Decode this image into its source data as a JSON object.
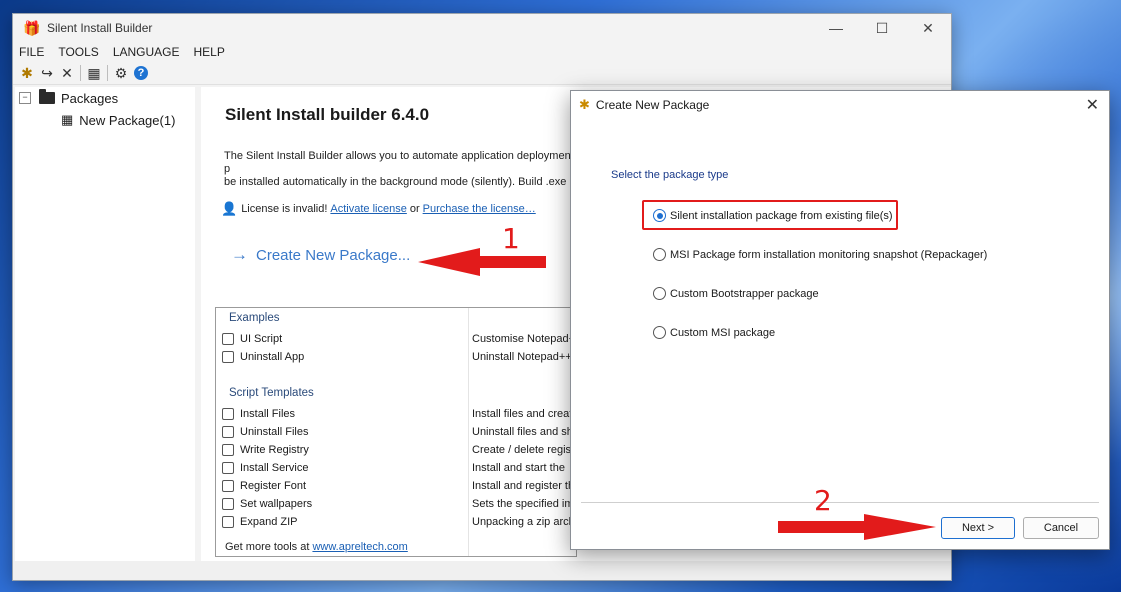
{
  "window": {
    "title": "Silent Install Builder",
    "controls": [
      "—",
      "☐",
      "✕"
    ]
  },
  "menu": [
    "FILE",
    "TOOLS",
    "LANGUAGE",
    "HELP"
  ],
  "toolbar": {
    "icons": [
      "new-package-icon",
      "undo-icon",
      "delete-icon",
      "build-icon",
      "settings-icon",
      "help-icon"
    ]
  },
  "tree": {
    "root": {
      "label": "Packages",
      "toggle": "−"
    },
    "child": {
      "label": "New Package(1)"
    }
  },
  "main": {
    "heading": "Silent Install builder 6.4.0",
    "description": "The Silent Install Builder allows you to automate application deployment p\nbe installed automatically in the background mode (silently).  Build .exe o\ndeployment with GPO, SCCM, Intune and other tools.",
    "license": {
      "text": "License is invalid!",
      "activate": "Activate license",
      "or": "or",
      "purchase": "Purchase the license…"
    },
    "create_link": "Create New Package...",
    "examples": {
      "title": "Examples",
      "items": [
        {
          "label": "UI Script",
          "desc": "Customise Notepad+"
        },
        {
          "label": "Uninstall App",
          "desc": "Uninstall Notepad++"
        }
      ]
    },
    "templates": {
      "title": "Script Templates",
      "items": [
        {
          "label": "Install Files",
          "desc": "Install files and creat"
        },
        {
          "label": "Uninstall Files",
          "desc": "Uninstall files and sh"
        },
        {
          "label": "Write Registry",
          "desc": "Create / delete regis"
        },
        {
          "label": "Install Service",
          "desc": "Install and start the"
        },
        {
          "label": "Register Font",
          "desc": "Install and register th"
        },
        {
          "label": "Set wallpapers",
          "desc": "Sets the specified im"
        },
        {
          "label": "Expand ZIP",
          "desc": "Unpacking a zip arch"
        }
      ]
    },
    "footer": {
      "text": "Get more tools at",
      "link": "www.apreltech.com"
    }
  },
  "dialog": {
    "title": "Create New Package",
    "prompt": "Select the package type",
    "options": [
      {
        "label": "Silent installation package from existing file(s)",
        "selected": true
      },
      {
        "label": "MSI Package form installation monitoring snapshot (Repackager)",
        "selected": false
      },
      {
        "label": "Custom Bootstrapper package",
        "selected": false
      },
      {
        "label": "Custom MSI package",
        "selected": false
      }
    ],
    "next": "Next >",
    "cancel": "Cancel"
  },
  "annotations": {
    "step1": "1",
    "step2": "2",
    "color": "#e21b1b"
  }
}
